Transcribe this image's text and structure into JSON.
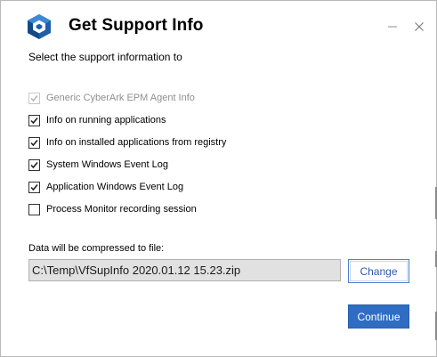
{
  "window": {
    "title": "Get Support Info",
    "minimize_icon": "minimize-icon",
    "close_icon": "close-icon",
    "logo_icon": "cyberark-logo"
  },
  "subtitle": "Select the support information to",
  "options": [
    {
      "label": "Generic CyberArk EPM Agent Info",
      "checked": true,
      "disabled": true
    },
    {
      "label": "Info on running applications",
      "checked": true,
      "disabled": false
    },
    {
      "label": "Info on installed applications from registry",
      "checked": true,
      "disabled": false
    },
    {
      "label": "System Windows Event Log",
      "checked": true,
      "disabled": false
    },
    {
      "label": "Application Windows Event Log",
      "checked": true,
      "disabled": false
    },
    {
      "label": "Process Monitor recording session",
      "checked": false,
      "disabled": false
    }
  ],
  "file": {
    "label": "Data will be compressed to file:",
    "value": "C:\\Temp\\VfSupInfo 2020.01.12 15.23.zip"
  },
  "buttons": {
    "change": "Change",
    "continue": "Continue"
  },
  "colors": {
    "accent": "#2f6dc2",
    "checkbox_border": "#333333",
    "disabled_text": "#8f8f8f",
    "field_background": "#e1e1e1"
  }
}
